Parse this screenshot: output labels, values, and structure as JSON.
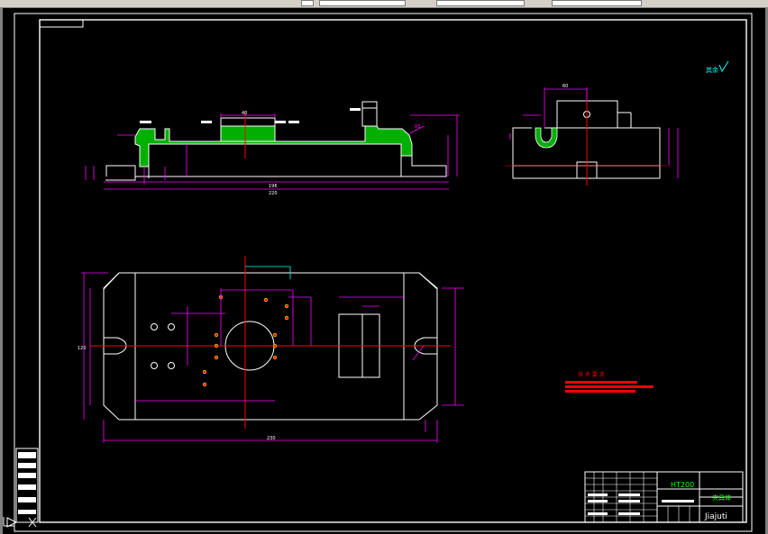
{
  "colors": {
    "background": "#000000",
    "outline": "#ffffff",
    "dimension": "#ff00ff",
    "center_line": "#ff0000",
    "hatch": "#00c000",
    "accent_cyan": "#00ffff",
    "note_red": "#ff0000",
    "title_green": "#00ff00"
  },
  "toolbar": {
    "icons": [
      "folder-icon",
      "pointer-icon",
      "layer-icon",
      "print-preview-icon",
      "properties-icon"
    ]
  },
  "drawing": {
    "surface_symbol": "其余",
    "tech_requirements_title": "技 术 要 求",
    "title_block": {
      "material": "HT200",
      "part_name": "夹具体",
      "school": "Jiajuti"
    },
    "dims": {
      "top_width": "40",
      "total_front": "220",
      "front_overall": "196",
      "r_label": "R5",
      "plan_width": "230",
      "plan_height": "120",
      "side_top": "60"
    },
    "ucs_icon": "ucs-icon"
  }
}
